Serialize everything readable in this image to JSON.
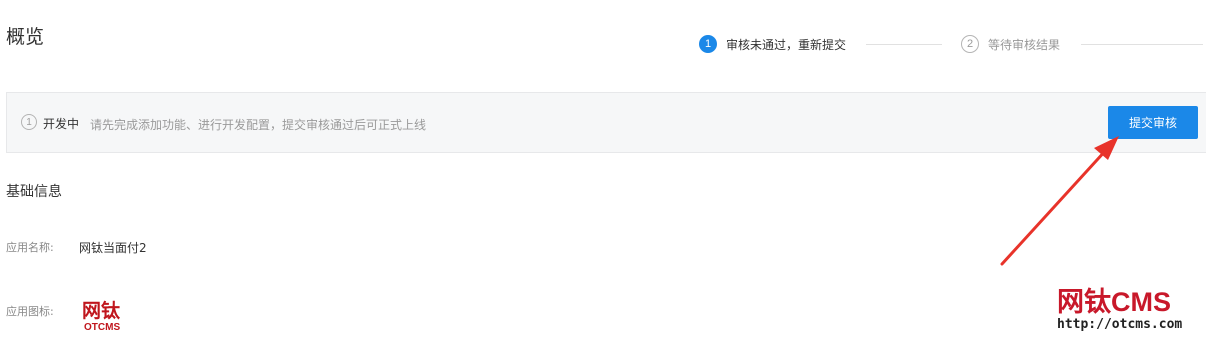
{
  "page": {
    "title": "概览"
  },
  "steps": [
    {
      "number": "1",
      "label": "审核未通过，重新提交",
      "state": "active"
    },
    {
      "number": "2",
      "label": "等待审核结果",
      "state": "pending"
    }
  ],
  "status": {
    "icon_number": "1",
    "label": "开发中",
    "description": "请先完成添加功能、进行开发配置，提交审核通过后可正式上线",
    "submit_label": "提交审核"
  },
  "basic_info": {
    "title": "基础信息",
    "app_name_label": "应用名称:",
    "app_name_value": "网钛当面付2",
    "app_icon_label": "应用图标:",
    "app_icon_text_cn": "网钛",
    "app_icon_text_en": "OTCMS"
  },
  "watermark": {
    "title": "网钛CMS",
    "url": "http://otcms.com"
  },
  "colors": {
    "accent": "#1b88e8",
    "arrow": "#e8332a",
    "brand_red": "#c8182a"
  }
}
